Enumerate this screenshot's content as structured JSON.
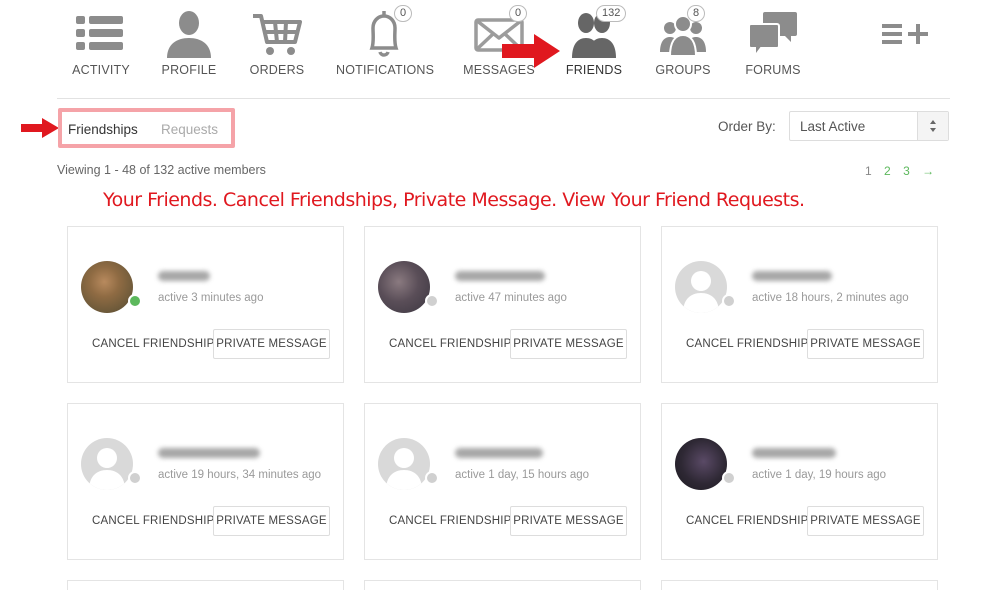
{
  "nav": [
    {
      "label": "ACTIVITY",
      "icon": "activity-icon"
    },
    {
      "label": "PROFILE",
      "icon": "profile-icon"
    },
    {
      "label": "ORDERS",
      "icon": "cart-icon"
    },
    {
      "label": "NOTIFICATIONS",
      "icon": "bell-icon",
      "count": "0"
    },
    {
      "label": "MESSAGES",
      "icon": "envelope-icon",
      "count": "0"
    },
    {
      "label": "FRIENDS",
      "icon": "friends-icon",
      "count": "132"
    },
    {
      "label": "GROUPS",
      "icon": "groups-icon",
      "count": "8"
    },
    {
      "label": "FORUMS",
      "icon": "forums-icon"
    },
    {
      "label": "",
      "icon": "more-menu-icon"
    }
  ],
  "subtabs": {
    "friendships": "Friendships",
    "requests": "Requests"
  },
  "order_by": {
    "label": "Order By:",
    "value": "Last Active"
  },
  "viewing": "Viewing 1 - 48 of 132 active members",
  "pagination": {
    "pages": [
      "1",
      "2",
      "3"
    ],
    "next": "→"
  },
  "headline": "Your Friends. Cancel Friendships, Private Message. View Your Friend Requests.",
  "card_actions": {
    "cancel": "CANCEL FRIENDSHIP",
    "message": "PRIVATE MESSAGE"
  },
  "members": [
    {
      "active": "active 3 minutes ago",
      "online": true
    },
    {
      "active": "active 47 minutes ago",
      "online": false
    },
    {
      "active": "active 18 hours, 2 minutes ago",
      "online": false
    },
    {
      "active": "active 19 hours, 34 minutes ago",
      "online": false
    },
    {
      "active": "active 1 day, 15 hours ago",
      "online": false
    },
    {
      "active": "active 1 day, 19 hours ago",
      "online": false
    }
  ],
  "colors": {
    "accent": "#5cb85c",
    "annotation": "#e0181f",
    "highlight_border": "#f5a3a8",
    "icon_gray": "#8c8c8c",
    "icon_active": "#666666"
  }
}
